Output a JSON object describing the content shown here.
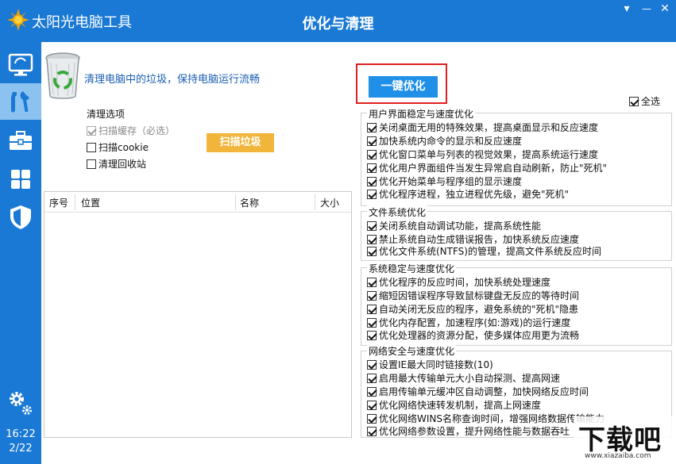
{
  "app": {
    "name": "太阳光电脑工具",
    "window_title": "优化与清理"
  },
  "window_controls": {
    "menu": "▾",
    "minimize": "—",
    "close": "✕"
  },
  "sidebar": {
    "items": [
      {
        "icon": "monitor-icon",
        "active": false
      },
      {
        "icon": "tools-icon",
        "active": true
      },
      {
        "icon": "toolbox-icon",
        "active": false
      },
      {
        "icon": "apps-grid-icon",
        "active": false
      },
      {
        "icon": "shield-icon",
        "active": false
      }
    ],
    "settings_icon": "gears-icon",
    "time": "16:22",
    "date": "2/22"
  },
  "header": {
    "text": "清理电脑中的垃圾，保持电脑运行流畅"
  },
  "one_key_button": "一键优化",
  "select_all": {
    "label": "全选",
    "checked": true
  },
  "clean_options": {
    "title": "清理选项",
    "items": [
      {
        "label": "扫描缓存（必选）",
        "checked": true,
        "disabled": true
      },
      {
        "label": "扫描cookie",
        "checked": false,
        "disabled": false
      },
      {
        "label": "清理回收站",
        "checked": false,
        "disabled": false
      }
    ]
  },
  "scan_button": "扫描垃圾",
  "table": {
    "columns": [
      "序号",
      "位置",
      "名称",
      "大小"
    ],
    "rows": []
  },
  "groups": [
    {
      "title": "用户界面稳定与速度优化",
      "items": [
        "关闭桌面无用的特殊效果，提高桌面显示和反应速度",
        "加快系统内命令的显示和反应速度",
        "优化窗口菜单与列表的视觉效果，提高系统运行速度",
        "优化用户界面组件当发生异常启自动刷新，防止\"死机\"",
        "优化开始菜单与程序组的显示速度",
        "优化程序进程，独立进程优先级，避免\"死机\""
      ]
    },
    {
      "title": "文件系统优化",
      "items": [
        "关闭系统自动调试功能，提高系统性能",
        "禁止系统自动生成错误报告，加快系统反应速度",
        "优化文件系统(NTFS)的管理，提高文件系统反应时间"
      ]
    },
    {
      "title": "系统稳定与速度优化",
      "items": [
        "优化程序的反应时间，加快系统处理速度",
        "缩短因错误程序导致鼠标键盘无反应的等待时间",
        "自动关闭无反应的程序，避免系统的\"死机\"隐患",
        "优化内存配置，加速程序(如:游戏)的运行速度",
        "优化处理器的资源分配，使多媒体应用更为流畅"
      ]
    },
    {
      "title": "网络安全与速度优化",
      "items": [
        "设置IE最大同时链接数(10)",
        "启用最大传输单元大小自动探测、提高网速",
        "启用传输单元缓冲区自动调整，加快网络反应时间",
        "优化网络快速转发机制，提高上网速度",
        "优化网络WINS名称查询时间，增强网络数据传输能力",
        "优化网络参数设置，提升网络性能与数据吞吐"
      ]
    }
  ],
  "watermark": {
    "text": "下载吧",
    "url": "www.xiazaiba.com"
  },
  "colors": {
    "primary": "#1a79d4",
    "sidebar_active": "#8cc2f0",
    "scan_button": "#f0b53a",
    "onekey_button": "#1f8fe8",
    "highlight_frame": "#e02020"
  }
}
